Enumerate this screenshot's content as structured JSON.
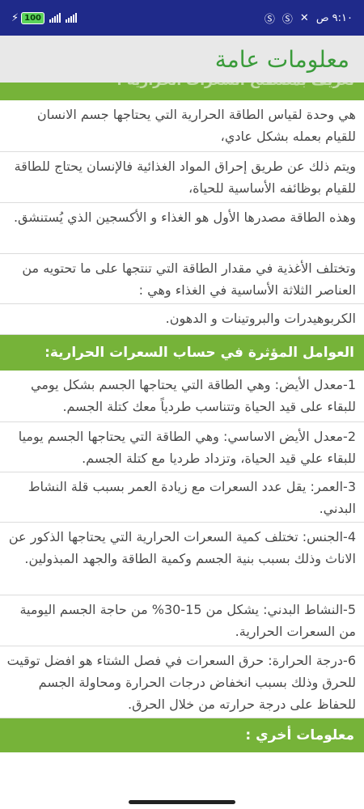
{
  "status_bar": {
    "battery": "100",
    "time": "٩:١٠ ص"
  },
  "app_bar": {
    "title": "معلومات عامة"
  },
  "sections": [
    {
      "header": "تعريف بمصطلح السعرات الحرارية :",
      "items": [
        "هي وحدة لقياس الطاقة الحرارية التي يحتاجها جسم الانسان للقيام بعمله بشكل عادي،",
        "ويتم ذلك عن طريق إحراق المواد الغذائية فالإنسان يحتاج للطاقة للقيام بوظائفه الأساسية للحياة،",
        "وهذه الطاقة مصدرها الأول هو الغذاء و الأكسجين الذي يُستنشق.",
        "وتختلف الأغذية في مقدار الطاقة التي تنتجها على ما تحتويه من العناصر الثلاثة الأساسية في الغذاء وهي :",
        "الكربوهيدرات والبروتينات و الدهون."
      ]
    },
    {
      "header": "العوامل المؤثرة في حساب السعرات الحرارية:",
      "items": [
        "1-معدل الأيض: وهي الطاقة التي يحتاجها الجسم بشكل يومي للبقاء على قيد الحياة وتتناسب طردياً معك كتلة الجسم.",
        "2-معدل الأيض الاساسي: وهي الطاقة التي يحتاجها الجسم يوميا للبقاء علي قيد الحياة، وتزداد طرديا مع كتلة الجسم.",
        "3-العمر: يقل عدد السعرات مع زيادة العمر بسبب قلة النشاط البدني.",
        "4-الجنس: تختلف كمية السعرات الحرارية التي يحتاجها الذكور عن الاناث وذلك بسبب بنية الجسم وكمية الطاقة والجهد المبذولين.",
        "5-النشاط البدني: يشكل من 15-30% من حاجة الجسم اليومية من السعرات الحرارية.",
        "6-درجة الحرارة: حرق السعرات في فصل الشتاء هو افضل توقيت للحرق وذلك بسبب انخفاض درجات الحرارة ومحاولة الجسم للحفاظ على درجة حرارته من خلال الحرق."
      ]
    },
    {
      "header": "معلومات أخري :",
      "items": []
    }
  ]
}
